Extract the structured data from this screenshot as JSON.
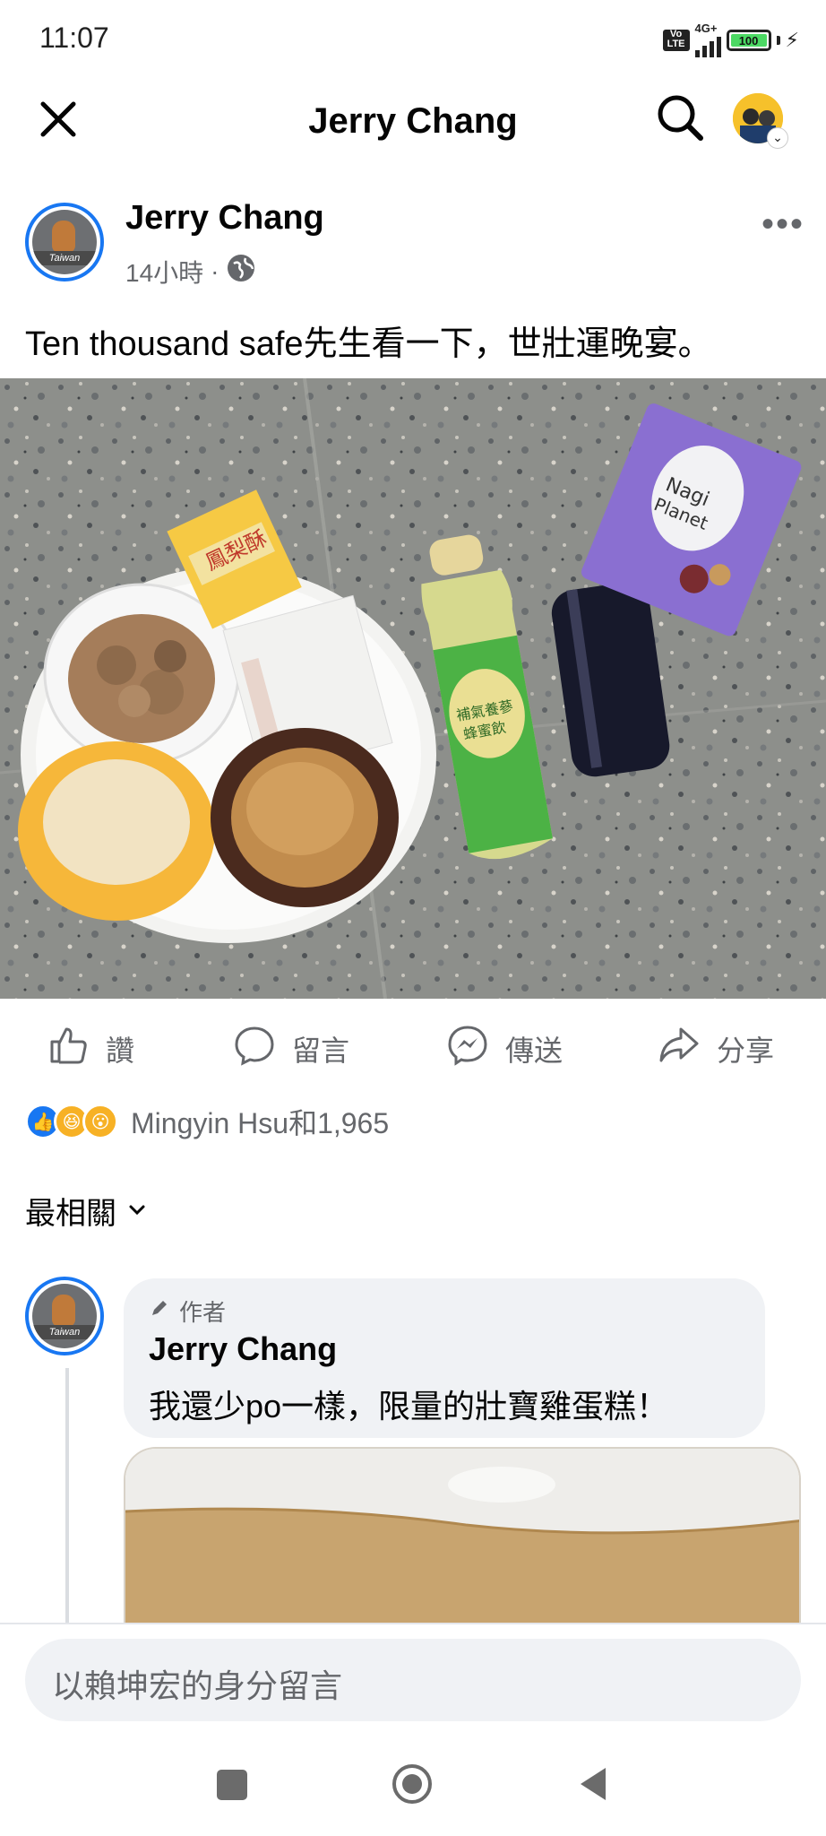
{
  "status_bar": {
    "time": "11:07",
    "volte": "Vo LTE",
    "network": "4G+",
    "battery": "100"
  },
  "header": {
    "title": "Jerry Chang",
    "close_icon": "close-icon",
    "search_icon": "search-icon"
  },
  "post": {
    "author": "Jerry Chang",
    "time": "14小時",
    "separator": "·",
    "avatar_tag": "Taiwan",
    "text": "Ten thousand safe先生看一下，世壯運晚宴。",
    "more": "•••"
  },
  "actions": [
    {
      "label": "讚",
      "icon": "thumbs-up-icon"
    },
    {
      "label": "留言",
      "icon": "comment-icon"
    },
    {
      "label": "傳送",
      "icon": "messenger-icon"
    },
    {
      "label": "分享",
      "icon": "share-icon"
    }
  ],
  "reactions": {
    "summary": "Mingyin Hsu和1,965"
  },
  "comments_sort": {
    "label": "最相關"
  },
  "comment": {
    "badge": "作者",
    "author": "Jerry Chang",
    "text": "我還少po一樣，限量的壯寶雞蛋糕！",
    "avatar_tag": "Taiwan"
  },
  "composer": {
    "placeholder": "以賴坤宏的身分留言"
  },
  "photo_labels": {
    "pastry_pack": "鳳梨酥",
    "bottle_label": "補氣養蔘蜂蜜飲",
    "snack_bag": "Nagi Planet"
  }
}
